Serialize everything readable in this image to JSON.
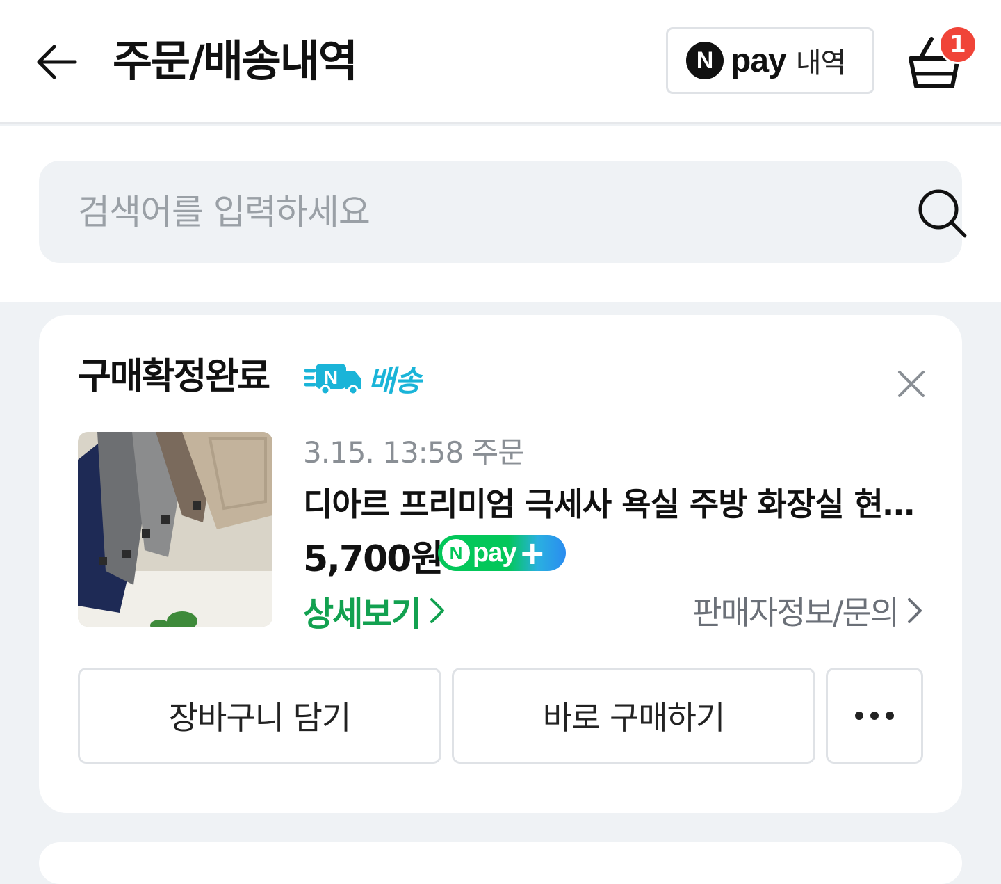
{
  "header": {
    "title": "주문/배송내역",
    "pay_history": {
      "n_mark": "N",
      "pay_word": "pay",
      "label": "내역"
    },
    "cart_badge_count": "1"
  },
  "search": {
    "placeholder": "검색어를 입력하세요",
    "value": ""
  },
  "order": {
    "status": "구매확정완료",
    "delivery_badge": {
      "n_mark": "N",
      "label": "배송"
    },
    "date": "3.15. 13:58 주문",
    "product_name": "디아르 프리미엄 극세사 욕실 주방 화장실 현...",
    "price": "5,700원",
    "npay_badge": {
      "n_mark": "N",
      "pay_word": "pay",
      "plus": "+"
    },
    "detail_link": "상세보기",
    "seller_link": "판매자정보/문의",
    "buttons": {
      "add_to_cart": "장바구니 담기",
      "buy_now": "바로 구매하기"
    }
  },
  "colors": {
    "accent_green": "#12a150",
    "badge_red": "#f04438",
    "delivery_cyan": "#1ab4d8",
    "background": "#eff2f5"
  }
}
